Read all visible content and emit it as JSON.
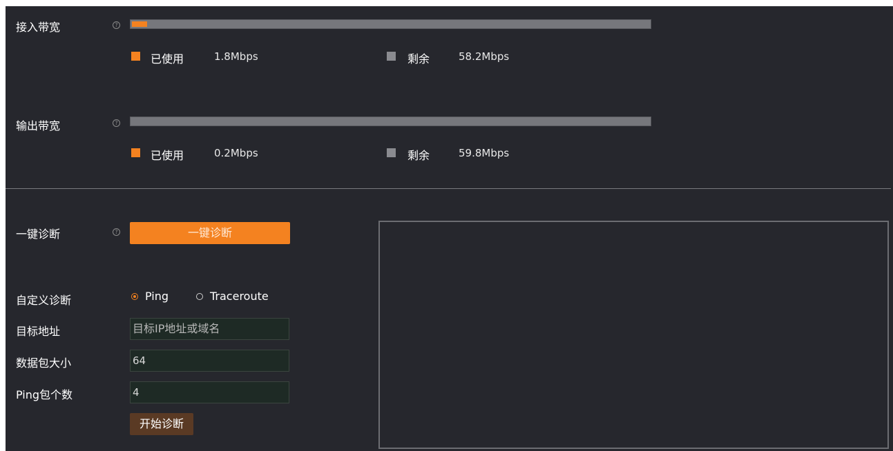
{
  "bandwidth_in": {
    "label": "接入带宽",
    "used_fraction": 0.03,
    "used_label": "已使用",
    "used_value": "1.8Mbps",
    "remain_label": "剩余",
    "remain_value": "58.2Mbps"
  },
  "bandwidth_out": {
    "label": "输出带宽",
    "used_fraction": 0.0,
    "used_label": "已使用",
    "used_value": "0.2Mbps",
    "remain_label": "剩余",
    "remain_value": "59.8Mbps"
  },
  "help_glyph": "?",
  "one_click": {
    "label": "一键诊断",
    "button": "一键诊断"
  },
  "custom": {
    "label": "自定义诊断",
    "options": [
      "Ping",
      "Traceroute"
    ],
    "selected": "Ping"
  },
  "target": {
    "label": "目标地址",
    "placeholder": "目标IP地址或域名",
    "value": ""
  },
  "packet_size": {
    "label": "数据包大小",
    "value": "64"
  },
  "ping_count": {
    "label": "Ping包个数",
    "value": "4"
  },
  "start_button": "开始诊断",
  "colors": {
    "accent": "#f48220",
    "panel": "#26272d",
    "remaining": "#8a8b90",
    "start_button": "#5a3a24"
  },
  "icons": {
    "help": "question-circle-icon",
    "used_legend": "orange-square-icon",
    "remain_legend": "gray-square-icon"
  }
}
